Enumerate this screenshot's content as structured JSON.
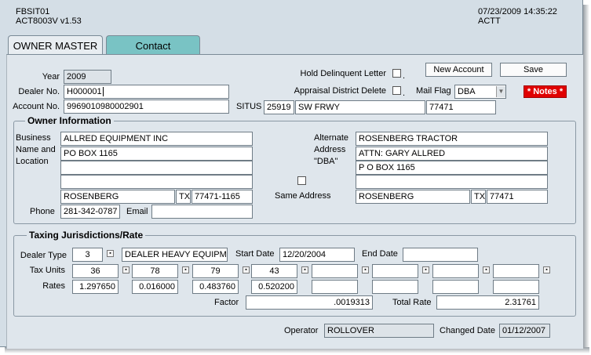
{
  "header": {
    "form_id": "FBSIT01",
    "version": "ACT8003V  v1.53",
    "datetime": "07/23/2009 14:35:22",
    "db": "ACTT"
  },
  "tabs": [
    {
      "label": "OWNER MASTER",
      "active": true
    },
    {
      "label": "Contact",
      "active": false
    }
  ],
  "top": {
    "year_label": "Year",
    "year_value": "2009",
    "dealer_no_label": "Dealer No.",
    "dealer_no_value": "H000001",
    "account_no_label": "Account No.",
    "account_no_value": "9969010980002901",
    "situs_label": "SITUS",
    "situs_number": "25919",
    "situs_street": "SW FRWY",
    "situs_zip": "77471",
    "hold_delinquent_label": "Hold Delinquent Letter",
    "appraisal_delete_label": "Appraisal District Delete",
    "mail_flag_label": "Mail Flag",
    "mail_flag_value": "DBA",
    "new_account_button": "New Account",
    "save_button": "Save",
    "notes_button": "* Notes *"
  },
  "owner": {
    "title": "Owner Information",
    "business_label_1": "Business",
    "business_label_2": "Name and",
    "business_label_3": "Location",
    "line1": "ALLRED EQUIPMENT INC",
    "line2": "PO BOX 1165",
    "line3": "",
    "line4": "",
    "city": "ROSENBERG",
    "state": "TX",
    "zip": "77471-1165",
    "phone_label": "Phone",
    "phone": "281-342-0787",
    "email_label": "Email",
    "email": "",
    "alt_label_1": "Alternate",
    "alt_label_2": "Address",
    "alt_label_3": "\"DBA\"",
    "alt_line1": "ROSENBERG TRACTOR",
    "alt_line2": "ATTN: GARY ALLRED",
    "alt_line3": "P O BOX 1165",
    "alt_line4": "",
    "alt_city": "ROSENBERG",
    "alt_state": "TX",
    "alt_zip": "77471",
    "same_address_label": "Same Address"
  },
  "taxing": {
    "title": "Taxing Jurisdictions/Rate",
    "dealer_type_label": "Dealer Type",
    "dealer_type_code": "3",
    "dealer_type_desc": "DEALER HEAVY EQUIPMEN",
    "start_date_label": "Start Date",
    "start_date": "12/20/2004",
    "end_date_label": "End Date",
    "end_date": "",
    "tax_units_label": "Tax Units",
    "tax_units": [
      "36",
      "78",
      "79",
      "43",
      "",
      "",
      "",
      ""
    ],
    "rates_label": "Rates",
    "rates": [
      "1.297650",
      "0.016000",
      "0.483760",
      "0.520200",
      "",
      "",
      "",
      ""
    ],
    "factor_label": "Factor",
    "factor": ".0019313",
    "total_rate_label": "Total Rate",
    "total_rate": "2.31761"
  },
  "footer": {
    "operator_label": "Operator",
    "operator": "ROLLOVER",
    "changed_date_label": "Changed Date",
    "changed_date": "01/12/2007"
  },
  "icons": {
    "spin": "spin-button-icon",
    "dropdown": "chevron-down-icon",
    "checkbox": "checkbox-icon"
  }
}
